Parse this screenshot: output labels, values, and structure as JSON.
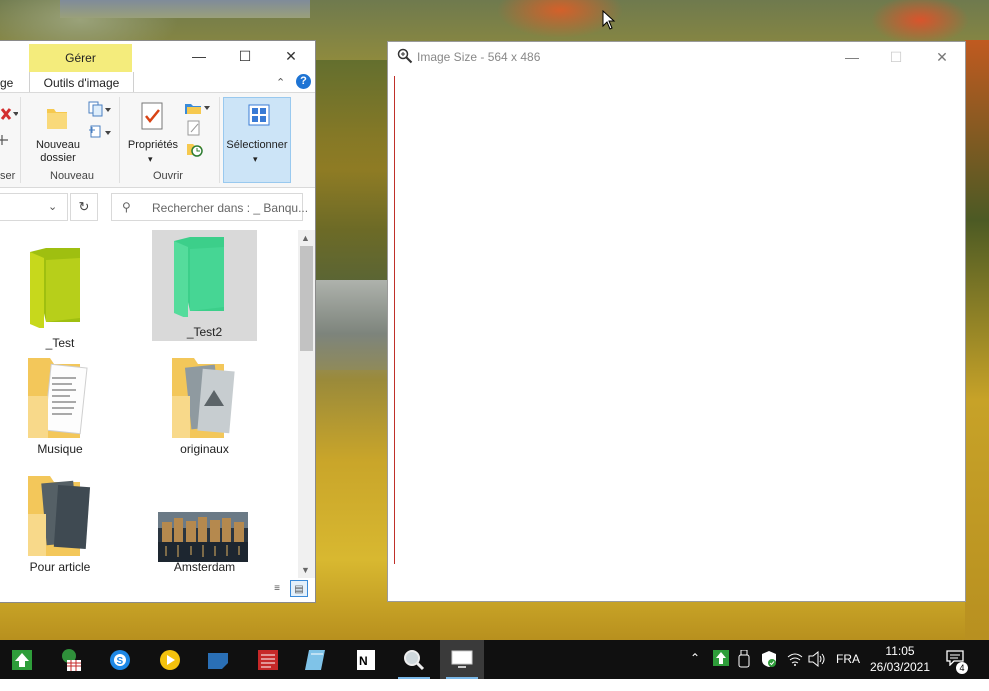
{
  "explorer": {
    "ribbon": {
      "context_tab": "Gérer",
      "partial_tab": "ge",
      "active_tab": "Outils d'image",
      "partial_group": "ser",
      "new_folder_label": "Nouveau dossier",
      "new_folder_line1": "Nouveau",
      "new_folder_line2": "dossier",
      "group_new": "Nouveau",
      "properties_label": "Propriétés",
      "group_open": "Ouvrir",
      "select_label": "Sélectionner"
    },
    "search_placeholder": "Rechercher dans : _ Banqu...",
    "items": [
      {
        "name": "_Test",
        "icon": "folder-green-yellow"
      },
      {
        "name": "_Test2",
        "icon": "folder-green",
        "selected": true
      },
      {
        "name": "Musique",
        "icon": "folder-with-document"
      },
      {
        "name": "originaux",
        "icon": "folder-with-photos"
      },
      {
        "name": "Pour article",
        "icon": "folder-with-photos"
      },
      {
        "name": "Amsterdam",
        "icon": "image-thumbnail"
      }
    ]
  },
  "image_window": {
    "title": "Image Size - 564 x 486",
    "icon": "magnifier-icon"
  },
  "taskbar": {
    "apps": [
      "update-arrow-icon",
      "spreadsheet-tree-icon",
      "skype-icon",
      "media-player-icon",
      "sticky-notes-icon",
      "news-icon",
      "notepad-glass-icon",
      "notepad-n-icon",
      "magnifier-icon",
      "monitor-icon"
    ],
    "language": "FRA",
    "time": "11:05",
    "date": "26/03/2021",
    "notification_count": "4"
  },
  "colors": {
    "context_tab": "#f4ec7c",
    "selection": "#cce4f7",
    "taskbar": "#101010"
  }
}
